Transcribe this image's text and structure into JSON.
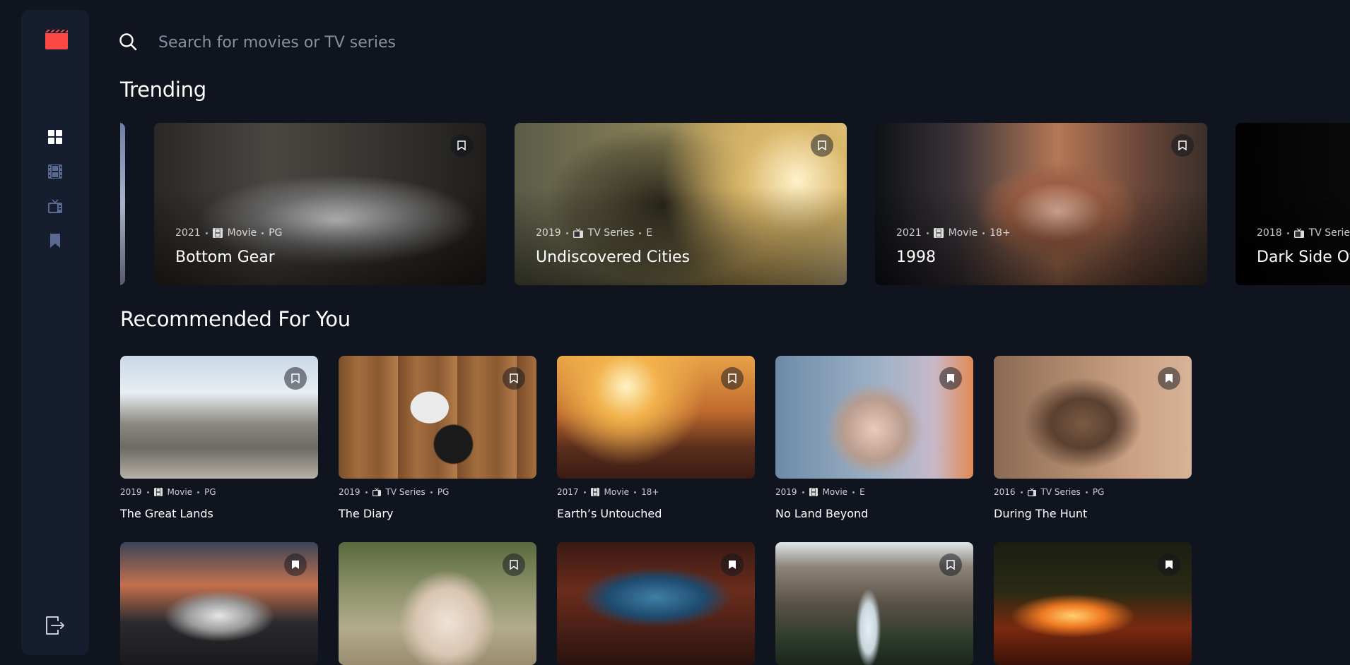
{
  "colors": {
    "background": "#10141e",
    "sidebar": "#161d2f",
    "accent": "#fc4747",
    "muted_icon": "#5a698f"
  },
  "sidebar": {
    "logo_icon": "clapperboard-icon",
    "nav": [
      {
        "name": "home",
        "icon": "grid-icon",
        "active": true
      },
      {
        "name": "movies",
        "icon": "film-icon",
        "active": false
      },
      {
        "name": "tv-series",
        "icon": "tv-icon",
        "active": false
      },
      {
        "name": "bookmarks",
        "icon": "bookmark-icon",
        "active": false
      }
    ],
    "logout_icon": "logout-icon"
  },
  "search": {
    "placeholder": "Search for movies or TV series",
    "value": ""
  },
  "trending": {
    "title": "Trending",
    "items": [
      {
        "year": "2021",
        "category": "Movie",
        "category_icon": "film-icon",
        "rating": "PG",
        "title": "Bottom Gear"
      },
      {
        "year": "2019",
        "category": "TV Series",
        "category_icon": "tv-icon",
        "rating": "E",
        "title": "Undiscovered Cities"
      },
      {
        "year": "2021",
        "category": "Movie",
        "category_icon": "film-icon",
        "rating": "18+",
        "title": "1998"
      },
      {
        "year": "2018",
        "category": "TV Series",
        "category_icon": "tv-icon",
        "rating": "",
        "title": "Dark Side Of"
      }
    ]
  },
  "recommended": {
    "title": "Recommended For You",
    "items": [
      {
        "year": "2019",
        "category": "Movie",
        "category_icon": "film-icon",
        "rating": "PG",
        "title": "The Great Lands"
      },
      {
        "year": "2019",
        "category": "TV Series",
        "category_icon": "tv-icon",
        "rating": "PG",
        "title": "The Diary"
      },
      {
        "year": "2017",
        "category": "Movie",
        "category_icon": "film-icon",
        "rating": "18+",
        "title": "Earth’s Untouched"
      },
      {
        "year": "2019",
        "category": "Movie",
        "category_icon": "film-icon",
        "rating": "E",
        "title": "No Land Beyond"
      },
      {
        "year": "2016",
        "category": "TV Series",
        "category_icon": "tv-icon",
        "rating": "PG",
        "title": "During The Hunt"
      }
    ]
  }
}
